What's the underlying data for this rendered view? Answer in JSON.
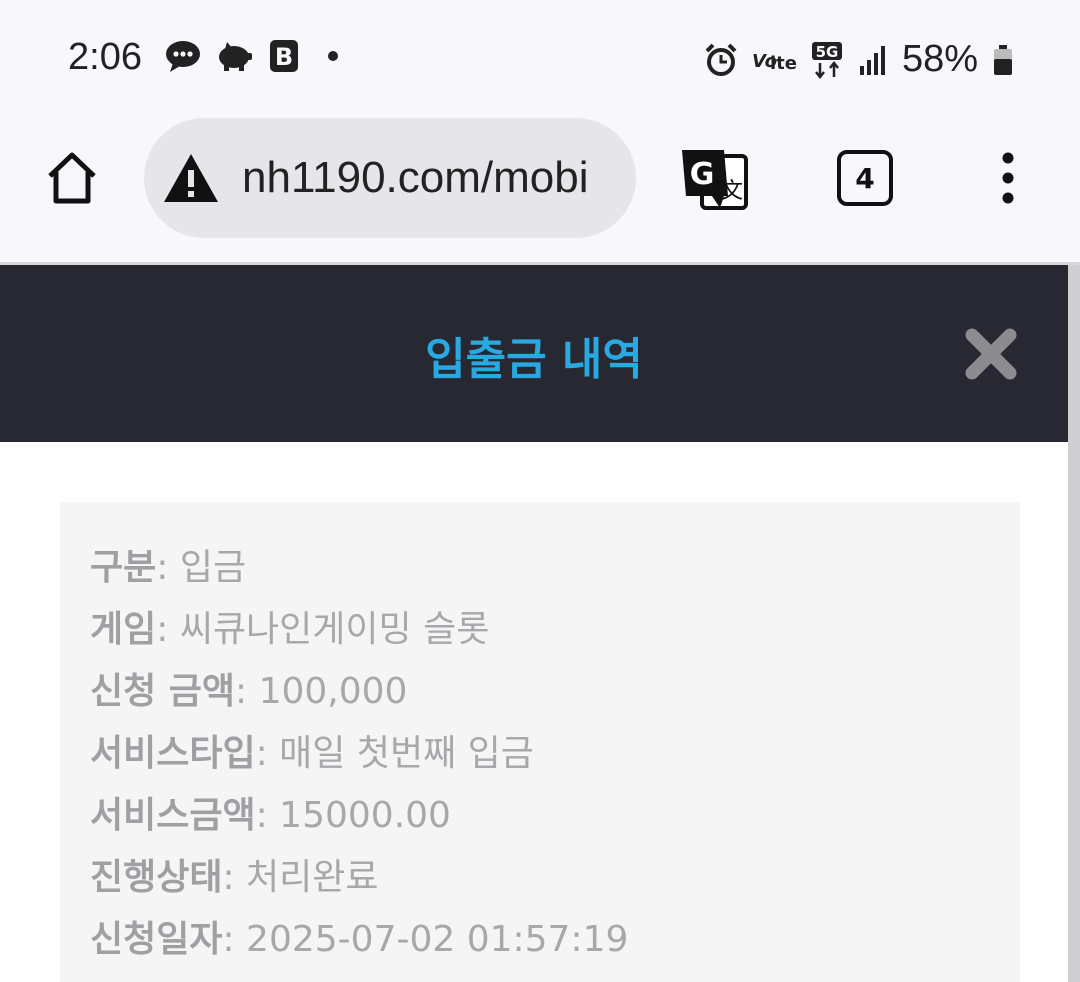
{
  "status_bar": {
    "time": "2:06",
    "battery_text": "58%",
    "left_icons": [
      "chat-bubble-icon",
      "piggy-bank-icon",
      "b-app-icon"
    ],
    "right_icons": [
      "alarm-icon",
      "volte-icon",
      "5g-icon",
      "signal-icon",
      "battery-icon"
    ]
  },
  "browser": {
    "url": "nh1190.com/mobi",
    "tab_count": "4"
  },
  "modal": {
    "title": "입출금 내역",
    "title_color": "#29a9e1",
    "rows": [
      {
        "label": "구분",
        "value": ": 입금"
      },
      {
        "label": "게임",
        "value": ": 씨큐나인게이밍 슬롯"
      },
      {
        "label": "신청 금액",
        "value": ": 100,000"
      },
      {
        "label": "서비스타입",
        "value": ": 매일 첫번째 입금"
      },
      {
        "label": "서비스금액",
        "value": ": 15000.00"
      },
      {
        "label": "진행상태",
        "value": ": 처리완료"
      },
      {
        "label": "신청일자",
        "value": ": 2025-07-02 01:57:19"
      }
    ]
  }
}
